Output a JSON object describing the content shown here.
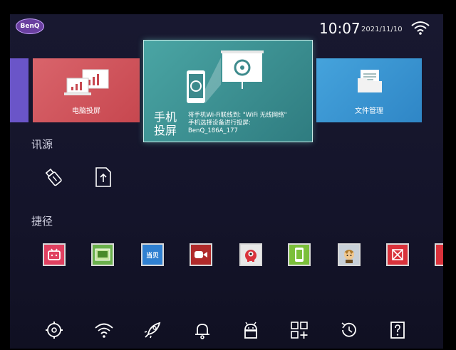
{
  "status_bar": {
    "brand": "BenQ",
    "time": "10:07",
    "date": "2021/11/10"
  },
  "tiles": {
    "pc_projection": {
      "label": "电脑投屏"
    },
    "phone_projection": {
      "title_line1": "手机",
      "title_line2": "投屏",
      "instruction_line1": "将手机Wi-Fi联线到: \"WiFi 无线网络\"",
      "instruction_line2": "手机选择设备进行投屏:",
      "device_name": "BenQ_186A_177"
    },
    "file_manager": {
      "label": "文件管理"
    }
  },
  "sections": {
    "source_title": "讯源",
    "shortcut_title": "捷径"
  },
  "shortcut_apps": [
    {
      "icon": "bilibili-icon",
      "color": "#e04060",
      "text": ""
    },
    {
      "icon": "video-player-icon",
      "color": "#6ab04c",
      "text": ""
    },
    {
      "icon": "dangbei-icon",
      "color": "#2f80d1",
      "text": "当贝"
    },
    {
      "icon": "video-camera-app-icon",
      "color": "#b02a2a",
      "text": ""
    },
    {
      "icon": "red-monster-app-icon",
      "color": "#e8e8e8",
      "text": ""
    },
    {
      "icon": "phone-app-icon",
      "color": "#7bbf3a",
      "text": ""
    },
    {
      "icon": "character-app-icon",
      "color": "#c8d0d8",
      "text": ""
    },
    {
      "icon": "wps-icon",
      "color": "#d9323b",
      "text": ""
    },
    {
      "icon": "partial-app-icon",
      "color": "#d9323b",
      "text": ""
    }
  ],
  "bottom_bar": [
    "settings-gear-icon",
    "wifi-icon",
    "rocket-icon",
    "bell-icon",
    "android-icon",
    "apps-add-icon",
    "history-icon",
    "help-icon"
  ]
}
